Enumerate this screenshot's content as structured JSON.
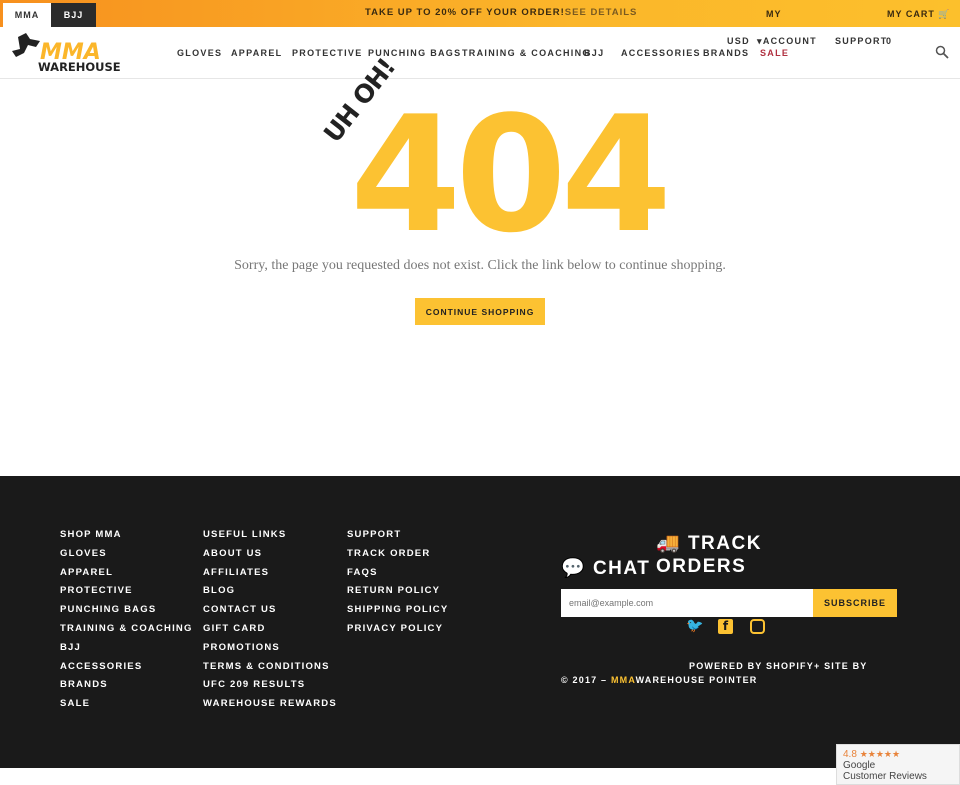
{
  "promo": {
    "tabs": [
      "MMA",
      "BJJ"
    ],
    "message": "TAKE UP TO 20% OFF YOUR ORDER!",
    "link": "SEE DETAILS",
    "my": "MY",
    "cart": "MY CART"
  },
  "header": {
    "logo_text": "MMA WAREHOUSE",
    "nav": [
      "GLOVES",
      "APPAREL",
      "PROTECTIVE",
      "PUNCHING BAGS",
      "TRAINING & COACHING",
      "BJJ",
      "ACCESSORIES",
      "BRANDS"
    ],
    "sale": "SALE",
    "currency": "USD",
    "account": "ACCOUNT",
    "support": "SUPPORT",
    "cart_count": "0"
  },
  "main": {
    "uhoh": "UH OH!",
    "code": "404",
    "message": "Sorry, the page you requested does not exist. Click the link below to continue shopping.",
    "cta": "CONTINUE SHOPPING"
  },
  "footer": {
    "columns": [
      {
        "title": "SHOP MMA",
        "items": [
          "GLOVES",
          "APPAREL",
          "PROTECTIVE",
          "PUNCHING BAGS",
          "TRAINING & COACHING",
          "BJJ",
          "ACCESSORIES",
          "BRANDS",
          "SALE"
        ]
      },
      {
        "title": "USEFUL LINKS",
        "items": [
          "ABOUT US",
          "AFFILIATES",
          "BLOG",
          "CONTACT US",
          "GIFT CARD",
          "PROMOTIONS",
          "TERMS & CONDITIONS",
          "UFC 209 RESULTS",
          "WAREHOUSE REWARDS"
        ]
      },
      {
        "title": "SUPPORT",
        "items": [
          "TRACK ORDER",
          "FAQS",
          "RETURN POLICY",
          "SHIPPING POLICY",
          "PRIVACY POLICY"
        ]
      }
    ],
    "chat": "CHAT",
    "track1": "TRACK",
    "track2": "ORDERS",
    "email_placeholder": "email@example.com",
    "subscribe": "SUBSCRIBE",
    "social": [
      "twitter-icon",
      "facebook-icon",
      "instagram-icon"
    ],
    "powered": "POWERED BY SHOPIFY+ SITE BY",
    "copy_prefix": "© 2017 –",
    "copy_brand": "MMA",
    "copy_rest": "WAREHOUSE POINTER"
  },
  "badge": {
    "rating": "4.8",
    "stars": "★★★★★",
    "line1": "Google",
    "line2": "Customer Reviews"
  },
  "colors": {
    "accent": "#fcc232",
    "promo_start": "#f7901e",
    "footer_bg": "#1a1a1a",
    "sale": "#c0392b"
  }
}
